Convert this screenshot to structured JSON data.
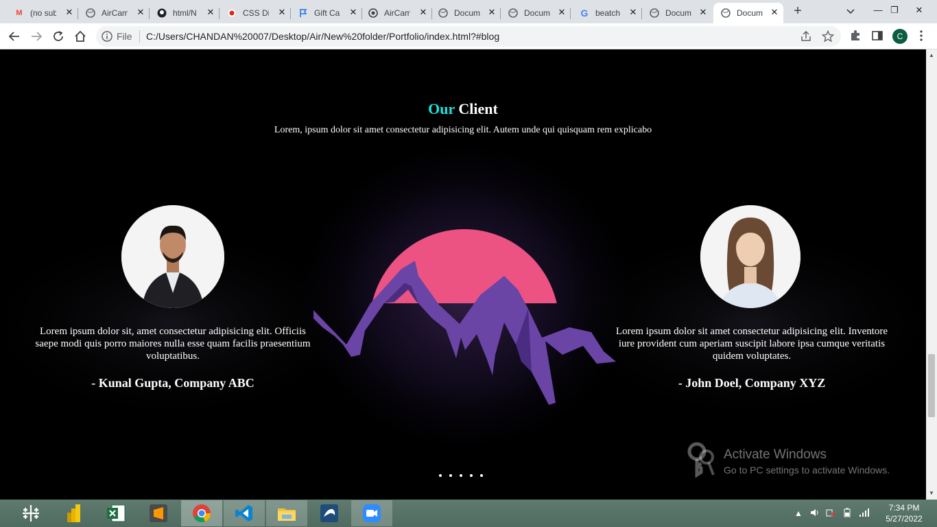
{
  "browser": {
    "tabs": [
      {
        "title": "(no subject)",
        "icon": "gmail-icon"
      },
      {
        "title": "AirCampus",
        "icon": "globe-icon"
      },
      {
        "title": "html/N",
        "icon": "github-icon"
      },
      {
        "title": "CSS Dir",
        "icon": "record-icon"
      },
      {
        "title": "Gift Card",
        "icon": "flag-icon"
      },
      {
        "title": "AirCampus",
        "icon": "shield-icon"
      },
      {
        "title": "Document",
        "icon": "globe-icon"
      },
      {
        "title": "Document",
        "icon": "globe-icon"
      },
      {
        "title": "beatch",
        "icon": "google-icon"
      },
      {
        "title": "Document",
        "icon": "globe-icon"
      },
      {
        "title": "Document",
        "icon": "globe-icon",
        "active": true
      }
    ],
    "address": {
      "scheme_label": "File",
      "url": "C:/Users/CHANDAN%20007/Desktop/Air/New%20folder/Portfolio/index.html?#blog"
    },
    "profile_initial": "C"
  },
  "page": {
    "section_title_accent": "Our",
    "section_title_rest": "Client",
    "section_subtitle": "Lorem, ipsum dolor sit amet consectetur adipisicing elit. Autem unde qui quisquam rem explicabo",
    "testimonials": [
      {
        "quote": "Lorem ipsum dolor sit, amet consectetur adipisicing elit. Officiis saepe modi quis porro maiores nulla esse quam facilis praesentium voluptatibus.",
        "author": "- Kunal Gupta, Company ABC"
      },
      {
        "quote": "Lorem ipsum dolor sit amet consectetur adipisicing elit. Inventore iure provident cum aperiam suscipit labore ipsa cumque veritatis quidem voluptates.",
        "author": "- John Doel, Company XYZ"
      }
    ],
    "slider_dots": 5
  },
  "watermark": {
    "line1": "Activate Windows",
    "line2": "Go to PC settings to activate Windows."
  },
  "taskbar": {
    "apps": [
      "tableau-icon",
      "powerbi-icon",
      "excel-icon",
      "sublime-icon",
      "chrome-icon",
      "vscode-icon",
      "file-explorer-icon",
      "mysql-workbench-icon",
      "zoom-icon"
    ],
    "time": "7:34 PM",
    "date": "5/27/2022"
  },
  "colors": {
    "accent": "#1de5e0",
    "sun": "#ec5383",
    "mountain": "#6a45a6"
  }
}
